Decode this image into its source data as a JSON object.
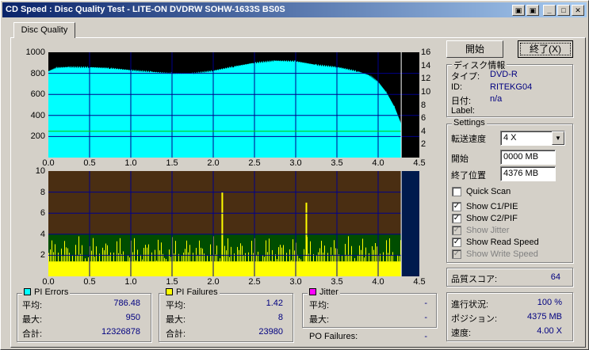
{
  "window": {
    "title": "CD Speed : Disc Quality Test - LITE-ON DVDRW SOHW-1633S BS0S",
    "btn_restore": "▣",
    "btn_min": "_",
    "btn_max": "□",
    "btn_close": "✕",
    "extra_icon": "▣"
  },
  "tab": {
    "label": "Disc Quality"
  },
  "chart_data": [
    {
      "type": "area",
      "title": "",
      "x_ticks": [
        "0.0",
        "0.5",
        "1.0",
        "1.5",
        "2.0",
        "2.5",
        "3.0",
        "3.5",
        "4.0",
        "4.5"
      ],
      "y_left_ticks": [
        "1000",
        "800",
        "600",
        "400",
        "200"
      ],
      "y_right_ticks": [
        "16",
        "14",
        "12",
        "10",
        "8",
        "6",
        "4",
        "2"
      ],
      "xlim": [
        0,
        4.5
      ],
      "ylim": [
        0,
        1000
      ],
      "y2lim": [
        0,
        16
      ],
      "grid": true,
      "end_x": 4.28,
      "series": [
        {
          "name": "PI Errors",
          "color": "#00ffff",
          "x": [
            0,
            0.1,
            0.25,
            0.5,
            0.75,
            1.0,
            1.25,
            1.5,
            1.75,
            2.0,
            2.25,
            2.5,
            2.75,
            3.0,
            3.25,
            3.5,
            3.75,
            3.9,
            4.0,
            4.1,
            4.2,
            4.25,
            4.28
          ],
          "y": [
            820,
            855,
            860,
            858,
            850,
            830,
            815,
            800,
            800,
            825,
            865,
            900,
            920,
            915,
            880,
            860,
            820,
            780,
            720,
            620,
            480,
            380,
            320
          ]
        },
        {
          "name": "Read Speed",
          "color": "#00cc00",
          "x": [
            0,
            4.28
          ],
          "y": [
            4.0,
            4.0
          ]
        }
      ]
    },
    {
      "type": "bar",
      "title": "",
      "x_ticks": [
        "0.0",
        "0.5",
        "1.0",
        "1.5",
        "2.0",
        "2.5",
        "3.0",
        "3.5",
        "4.0",
        "4.5"
      ],
      "y_ticks": [
        "10",
        "8",
        "6",
        "4",
        "2"
      ],
      "xlim": [
        0,
        4.5
      ],
      "ylim": [
        0,
        10
      ],
      "grid": true,
      "end_x": 4.28,
      "series": [
        {
          "name": "PI Failures",
          "color": "#ffff00",
          "baseline": 1.42,
          "max": 8,
          "spikes_x": [
            2.1,
            3.12
          ],
          "spikes_y": [
            8,
            7
          ]
        }
      ]
    }
  ],
  "pi_errors": {
    "title": "PI Errors",
    "color": "#00ffff",
    "avg_label": "平均:",
    "avg": "786.48",
    "max_label": "最大:",
    "max": "950",
    "total_label": "合計:",
    "total": "12326878"
  },
  "pi_failures": {
    "title": "PI Failures",
    "color": "#ffff00",
    "avg_label": "平均:",
    "avg": "1.42",
    "max_label": "最大:",
    "max": "8",
    "total_label": "合計:",
    "total": "23980"
  },
  "jitter": {
    "title": "Jitter",
    "color": "#ff00ff",
    "avg_label": "平均:",
    "avg": "-",
    "max_label": "最大:",
    "max": "-"
  },
  "po_failures": {
    "label": "PO Failures:",
    "value": "-"
  },
  "buttons": {
    "start": "開始",
    "end": "終了(X)"
  },
  "disc_info": {
    "title": "ディスク情報",
    "type_label": "タイプ:",
    "type": "DVD-R",
    "id_label": "ID:",
    "id": "RITEKG04",
    "date_label": "日付:",
    "date": "n/a",
    "label_label": "Label:",
    "label": ""
  },
  "settings": {
    "title": "Settings",
    "speed_label": "転送速度",
    "speed": "4 X",
    "start_label": "開始",
    "start": "0000 MB",
    "end_label": "終了位置",
    "end": "4376 MB",
    "quick_scan": "Quick Scan",
    "show_c1": "Show C1/PIE",
    "show_c2": "Show C2/PIF",
    "show_jitter": "Show Jitter",
    "show_read": "Show Read Speed",
    "show_write": "Show Write Speed"
  },
  "score": {
    "label": "品質スコア:",
    "value": "64"
  },
  "status": {
    "progress_label": "進行状況:",
    "progress": "100 %",
    "position_label": "ポジション:",
    "position": "4375 MB",
    "speed_label": "速度:",
    "speed": "4.00 X"
  }
}
